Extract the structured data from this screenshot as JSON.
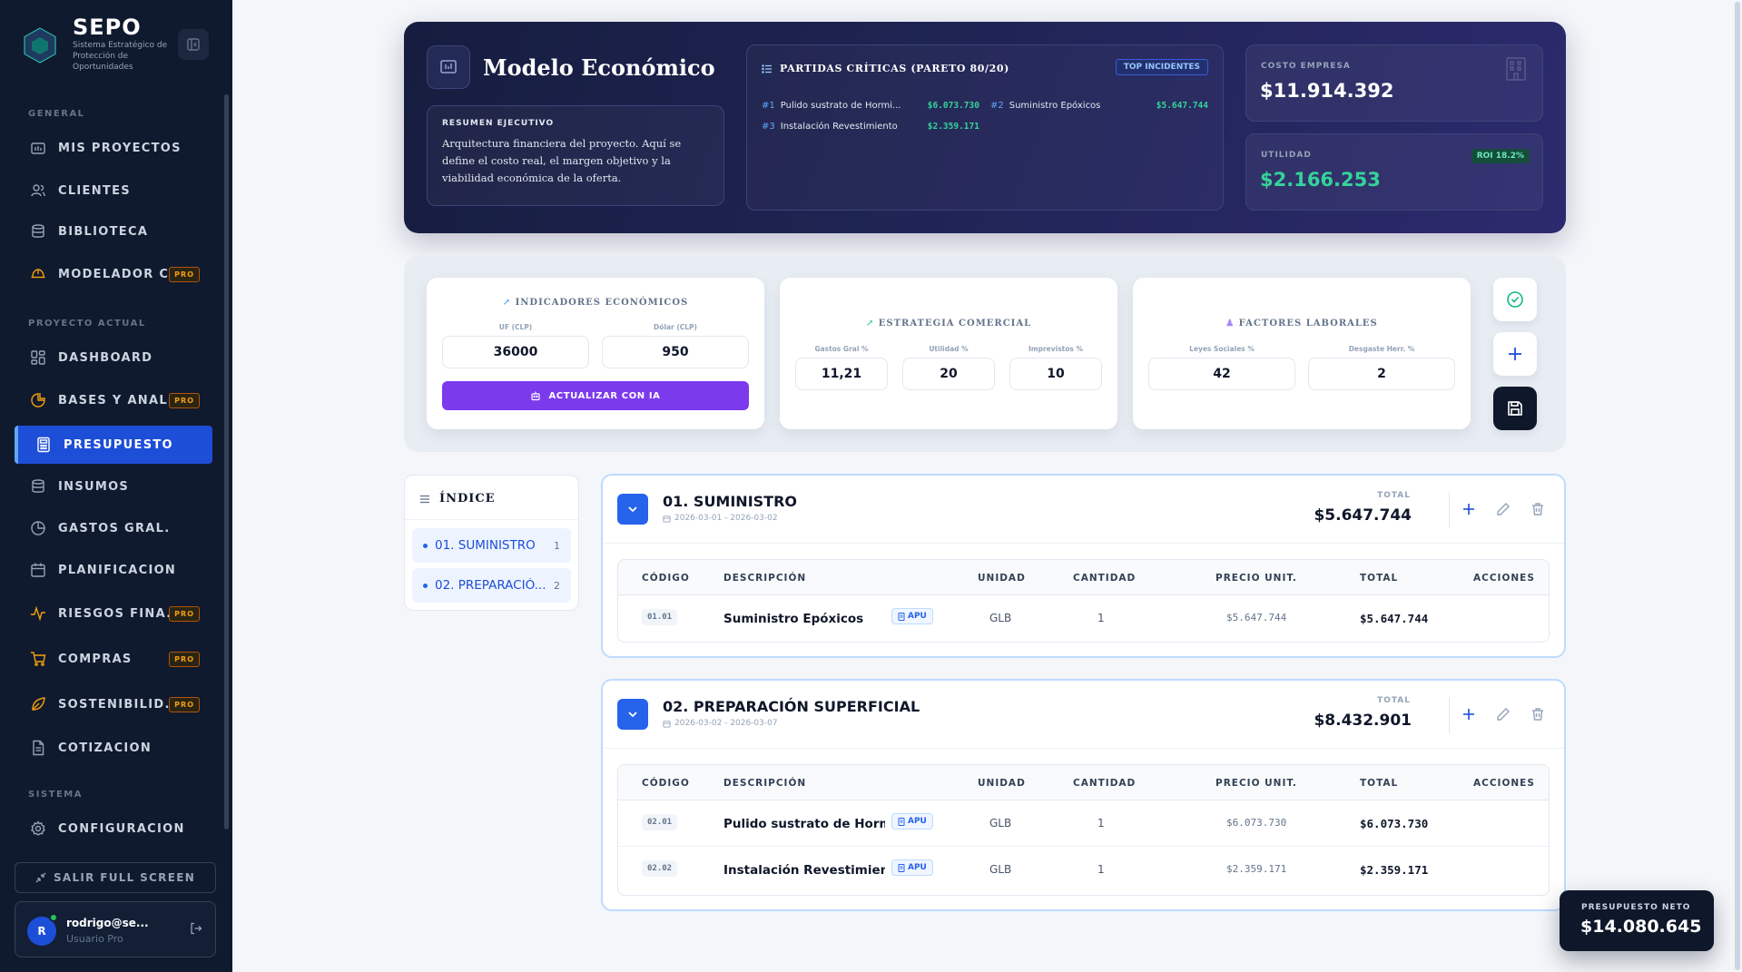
{
  "sidebar": {
    "brand_name": "SEPO",
    "brand_sub": "Sistema Estratégico de Protección de Oportunidades",
    "section_general": "GENERAL",
    "section_project": "PROYECTO ACTUAL",
    "section_system": "SISTEMA",
    "items": [
      {
        "label": "MIS PROYECTOS",
        "icon": "briefcase-icon"
      },
      {
        "label": "CLIENTES",
        "icon": "users-icon"
      },
      {
        "label": "BIBLIOTECA",
        "icon": "database-icon"
      },
      {
        "label": "MODELADOR C...",
        "icon": "hardhat-icon",
        "pro": "PRO"
      },
      {
        "label": "DASHBOARD",
        "icon": "grid-icon"
      },
      {
        "label": "BASES Y ANÁL...",
        "icon": "chart-icon",
        "pro": "PRO"
      },
      {
        "label": "PRESUPUESTO",
        "icon": "calculator-icon"
      },
      {
        "label": "INSUMOS",
        "icon": "database-icon"
      },
      {
        "label": "GASTOS GRAL.",
        "icon": "pie-icon"
      },
      {
        "label": "PLANIFICACIÓN",
        "icon": "calendar-icon"
      },
      {
        "label": "RIESGOS FINA...",
        "icon": "pulse-icon",
        "pro": "PRO"
      },
      {
        "label": "COMPRAS",
        "icon": "cart-icon",
        "pro": "PRO"
      },
      {
        "label": "SOSTENIBILID...",
        "icon": "leaf-icon",
        "pro": "PRO"
      },
      {
        "label": "COTIZACIÓN",
        "icon": "file-icon"
      },
      {
        "label": "CONFIGURACIÓN",
        "icon": "gear-icon"
      }
    ],
    "exit_label": "SALIR FULL SCREEN",
    "user": {
      "initial": "R",
      "name": "rodrigo@se...",
      "role": "Usuario Pro"
    }
  },
  "hero": {
    "title": "Modelo Económico",
    "summary_title": "RESUMEN EJECUTIVO",
    "summary_text": "Arquitectura financiera del proyecto. Aquí se define el costo real, el margen objetivo y la viabilidad económica de la oferta.",
    "pareto_title": "PARTIDAS CRÍTICAS (PARETO 80/20)",
    "pareto_badge": "TOP INCIDENTES",
    "pareto": [
      {
        "rank": "#1",
        "name": "Pulido sustrato de Hormi...",
        "value": "$6.073.730"
      },
      {
        "rank": "#2",
        "name": "Suministro Epóxicos",
        "value": "$5.647.744"
      },
      {
        "rank": "#3",
        "name": "Instalación Revestimiento",
        "value": "$2.359.171"
      }
    ],
    "cost_label": "COSTO EMPRESA",
    "cost_value": "$11.914.392",
    "utility_label": "UTILIDAD",
    "utility_value": "$2.166.253",
    "roi": "ROI 18.2%"
  },
  "indicators": {
    "econ_title": "INDICADORES ECONÓMICOS",
    "uf_label": "UF (CLP)",
    "uf_value": "36000",
    "usd_label": "Dólar (CLP)",
    "usd_value": "950",
    "ai_button": "ACTUALIZAR CON IA",
    "comm_title": "ESTRATEGIA COMERCIAL",
    "gg_label": "Gastos Gral %",
    "gg_value": "11,21",
    "util_label": "Utilidad %",
    "util_value": "20",
    "impr_label": "Imprevistos %",
    "impr_value": "10",
    "labor_title": "FACTORES LABORALES",
    "leyes_label": "Leyes Sociales %",
    "leyes_value": "42",
    "desg_label": "Desgaste Herr. %",
    "desg_value": "2"
  },
  "index": {
    "title": "ÍNDICE",
    "items": [
      {
        "label": "01. SUMINISTRO",
        "count": "1"
      },
      {
        "label": "02. PREPARACIÓ...",
        "count": "2"
      }
    ]
  },
  "table_headers": [
    "CÓDIGO",
    "DESCRIPCIÓN",
    "UNIDAD",
    "CANTIDAD",
    "PRECIO UNIT.",
    "TOTAL",
    "ACCIONES"
  ],
  "total_label": "TOTAL",
  "apu_label": "APU",
  "chapters": [
    {
      "title": "01. SUMINISTRO",
      "dates": "2026-03-01 - 2026-03-02",
      "total": "$5.647.744",
      "rows": [
        {
          "code": "01.01",
          "desc": "Suministro Epóxicos",
          "unit": "GLB",
          "qty": "1",
          "price": "$5.647.744",
          "total": "$5.647.744"
        }
      ]
    },
    {
      "title": "02. PREPARACIÓN SUPERFICIAL",
      "dates": "2026-03-02 - 2026-03-07",
      "total": "$8.432.901",
      "rows": [
        {
          "code": "02.01",
          "desc": "Pulido sustrato de Horm...",
          "unit": "GLB",
          "qty": "1",
          "price": "$6.073.730",
          "total": "$6.073.730"
        },
        {
          "code": "02.02",
          "desc": "Instalación Revestimiento",
          "unit": "GLB",
          "qty": "1",
          "price": "$2.359.171",
          "total": "$2.359.171"
        }
      ]
    }
  ],
  "net": {
    "label": "PRESUPUESTO NETO",
    "value": "$14.080.645"
  },
  "colors": {
    "sidebar": "#0f1a2e",
    "accent": "#2563eb",
    "ai": "#7c3aed",
    "profit": "#34d399",
    "pro": "#f59e0b"
  }
}
